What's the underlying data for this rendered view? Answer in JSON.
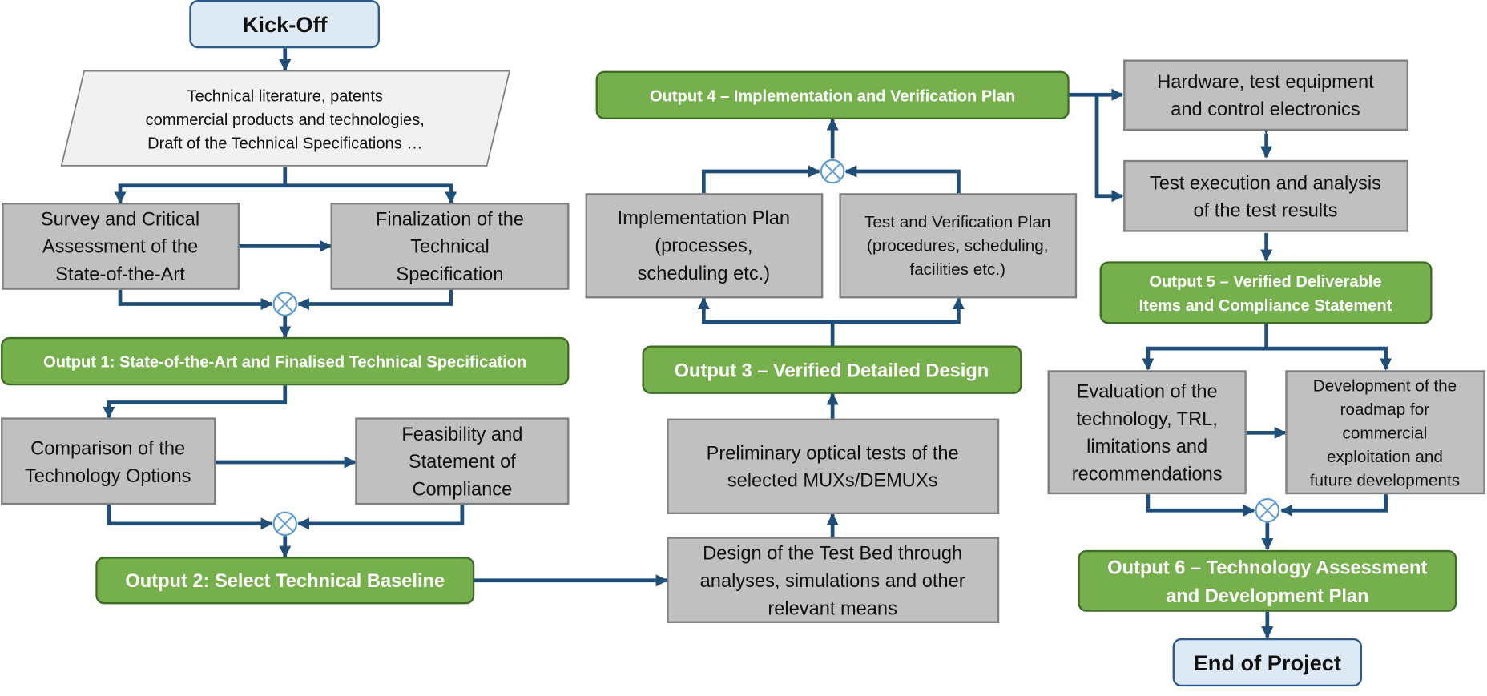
{
  "diagram": {
    "kickoff": "Kick-Off",
    "inputs": [
      "Technical literature, patents",
      "commercial products and technologies,",
      "Draft of the Technical Specifications …"
    ],
    "survey": [
      "Survey and Critical",
      "Assessment  of the",
      "State-of-the-Art"
    ],
    "finalization": [
      "Finalization of the",
      "Technical",
      "Specification"
    ],
    "output1": "Output 1: State-of-the-Art and Finalised Technical Specification",
    "comparison": [
      "Comparison of the",
      "Technology Options"
    ],
    "feasibility": [
      "Feasibility and",
      "Statement of",
      "Compliance"
    ],
    "output2": "Output 2:  Select Technical Baseline",
    "design_test_bed": [
      "Design of the Test Bed through",
      "analyses, simulations and other",
      "relevant means"
    ],
    "preliminary_tests": [
      "Preliminary optical tests of the",
      "selected MUXs/DEMUXs"
    ],
    "output3": "Output 3 – Verified Detailed Design",
    "implementation_plan": [
      "Implementation Plan",
      "(processes,",
      "scheduling etc.)"
    ],
    "test_verification_plan": [
      "Test and Verification Plan",
      "(procedures, scheduling,",
      "facilities etc.)"
    ],
    "output4": "Output 4 – Implementation and Verification Plan",
    "hardware": [
      "Hardware, test equipment",
      "and control electronics"
    ],
    "test_execution": [
      "Test execution and analysis",
      "of the test results"
    ],
    "output5": [
      "Output 5 – Verified Deliverable",
      "Items and Compliance Statement"
    ],
    "evaluation": [
      "Evaluation of the",
      "technology, TRL,",
      "limitations and",
      "recommendations"
    ],
    "roadmap": [
      "Development of the",
      "roadmap for",
      "commercial",
      "exploitation and",
      "future developments"
    ],
    "output6": [
      "Output 6 – Technology Assessment",
      "and Development Plan"
    ],
    "end": "End of Project"
  },
  "colors": {
    "process_fill": "#c0c0c0",
    "output_fill": "#76b04d",
    "terminal_fill": "#dde9f5",
    "connector": "#1f4e79",
    "junction": "#5b9bd5"
  }
}
